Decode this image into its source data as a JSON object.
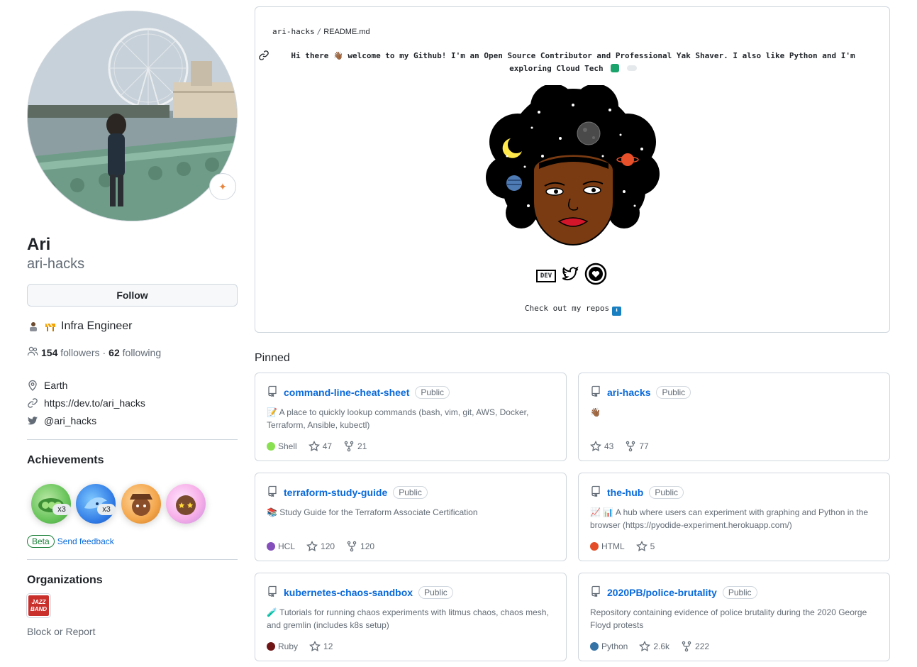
{
  "profile": {
    "name": "Ari",
    "login": "ari-hacks",
    "follow_label": "Follow",
    "bio": "Infra Engineer",
    "followers_count": "154",
    "followers_label": "followers",
    "dot": "·",
    "following_count": "62",
    "following_label": "following",
    "location": "Earth",
    "website": "https://dev.to/ari_hacks",
    "twitter": "@ari_hacks"
  },
  "achievements": {
    "title": "Achievements",
    "items": [
      {
        "name": "pair-extraordinaire",
        "count": "x3"
      },
      {
        "name": "pull-shark",
        "count": "x3"
      },
      {
        "name": "yolo",
        "count": ""
      },
      {
        "name": "starstruck",
        "count": ""
      }
    ],
    "beta_label": "Beta",
    "feedback_label": "Send feedback"
  },
  "organizations": {
    "title": "Organizations",
    "logo_lines": [
      "JAZZ",
      "BAND"
    ],
    "block_label": "Block or Report"
  },
  "readme": {
    "owner": "ari-hacks",
    "slash": "/",
    "file": "README.md",
    "intro": "Hi there 👋🏾 welcome to my Github! I'm an Open Source Contributor and Professional Yak Shaver. I also like Python and I'm exploring Cloud Tech",
    "social_dev_label": "DEV",
    "cta": "Check out my repos",
    "cta_arrow": "⬇"
  },
  "pinned": {
    "title": "Pinned",
    "repos": [
      {
        "name": "command-line-cheat-sheet",
        "visibility": "Public",
        "description": "📝 A place to quickly lookup commands (bash, vim, git, AWS, Docker, Terraform, Ansible, kubectl)",
        "language": "Shell",
        "lang_color": "#89e051",
        "stars": "47",
        "forks": "21"
      },
      {
        "name": "ari-hacks",
        "visibility": "Public",
        "description": "👋🏾",
        "language": "",
        "lang_color": "",
        "stars": "43",
        "forks": "77"
      },
      {
        "name": "terraform-study-guide",
        "visibility": "Public",
        "description": "📚 Study Guide for the Terraform Associate Certification",
        "language": "HCL",
        "lang_color": "#844fba",
        "stars": "120",
        "forks": "120"
      },
      {
        "name": "the-hub",
        "visibility": "Public",
        "description": "📈 📊 A hub where users can experiment with graphing and Python in the browser (https://pyodide-experiment.herokuapp.com/)",
        "language": "HTML",
        "lang_color": "#e34c26",
        "stars": "5",
        "forks": ""
      },
      {
        "name": "kubernetes-chaos-sandbox",
        "visibility": "Public",
        "description": "🧪 Tutorials for running chaos experiments with litmus chaos, chaos mesh, and gremlin (includes k8s setup)",
        "language": "Ruby",
        "lang_color": "#701516",
        "stars": "12",
        "forks": ""
      },
      {
        "name": "2020PB/police-brutality",
        "visibility": "Public",
        "description": "Repository containing evidence of police brutality during the 2020 George Floyd protests",
        "language": "Python",
        "lang_color": "#3572A5",
        "stars": "2.6k",
        "forks": "222"
      }
    ]
  }
}
